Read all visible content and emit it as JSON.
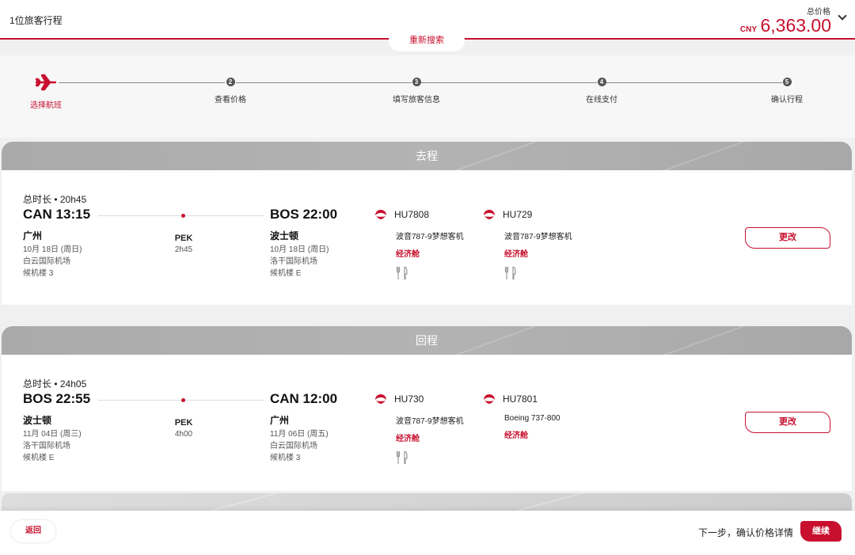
{
  "header": {
    "title": "1位旅客行程",
    "price_label": "总价格",
    "currency": "CNY",
    "total_price": "6,363.00",
    "research_label": "重新搜索"
  },
  "steps": [
    {
      "num": "",
      "label": "选择航班",
      "active": true
    },
    {
      "num": "2",
      "label": "查看价格"
    },
    {
      "num": "3",
      "label": "填写旅客信息"
    },
    {
      "num": "4",
      "label": "在线支付"
    },
    {
      "num": "5",
      "label": "确认行程"
    }
  ],
  "outbound": {
    "heading": "去程",
    "duration": "总时长 • 20h45",
    "from_time": "CAN 13:15",
    "from_city": "广州",
    "from_date": "10月 18日 (周日)",
    "from_airport": "白云国际机场",
    "from_terminal": "候机楼 3",
    "stop_code": "PEK",
    "stop_time": "2h45",
    "to_time": "BOS 22:00",
    "to_city": "波士顿",
    "to_date": "10月 18日 (周日)",
    "to_airport": "洛干国际机场",
    "to_terminal": "候机楼 E",
    "flights": [
      {
        "no": "HU7808",
        "aircraft": "波音787-9梦想客机",
        "cabin": "经济舱",
        "meal": true
      },
      {
        "no": "HU729",
        "aircraft": "波音787-9梦想客机",
        "cabin": "经济舱",
        "meal": true
      }
    ],
    "change_label": "更改"
  },
  "return": {
    "heading": "回程",
    "duration": "总时长 • 24h05",
    "from_time": "BOS 22:55",
    "from_city": "波士顿",
    "from_date": "11月 04日 (周三)",
    "from_airport": "洛干国际机场",
    "from_terminal": "候机楼 E",
    "stop_code": "PEK",
    "stop_time": "4h00",
    "to_time": "CAN 12:00",
    "to_city": "广州",
    "to_date": "11月 06日 (周五)",
    "to_airport": "白云国际机场",
    "to_terminal": "候机楼 3",
    "flights": [
      {
        "no": "HU730",
        "aircraft": "波音787-9梦想客机",
        "cabin": "经济舱",
        "meal": true
      },
      {
        "no": "HU7801",
        "aircraft": "Boeing 737-800",
        "cabin": "经济舱",
        "meal": false
      }
    ],
    "change_label": "更改"
  },
  "footer": {
    "back_label": "返回",
    "next_text": "下一步，确认价格详情",
    "continue_label": "继续"
  },
  "colors": {
    "accent": "#c8102e",
    "section_head": "#b0b0b0"
  }
}
